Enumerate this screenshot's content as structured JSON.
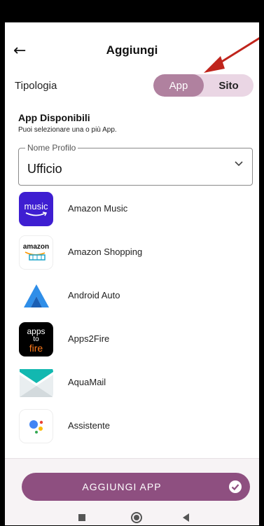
{
  "header": {
    "title": "Aggiungi",
    "back_icon": "arrow-left-icon"
  },
  "annotation": {
    "arrow_color": "#c0241c"
  },
  "tipologia": {
    "label": "Tipologia",
    "options": [
      "App",
      "Sito"
    ],
    "selected": "App"
  },
  "section": {
    "title": "App Disponibili",
    "subtitle": "Puoi selezionare una o più App."
  },
  "profile": {
    "label": "Nome Profilo",
    "value": "Ufficio"
  },
  "apps": [
    {
      "name": "Amazon Music",
      "icon_text": "music"
    },
    {
      "name": "Amazon Shopping",
      "icon_text": "amazon"
    },
    {
      "name": "Android Auto"
    },
    {
      "name": "Apps2Fire",
      "icon_lines": [
        "apps",
        "to",
        "fire"
      ]
    },
    {
      "name": "AquaMail"
    },
    {
      "name": "Assistente"
    }
  ],
  "action": {
    "label": "AGGIUNGI APP"
  },
  "colors": {
    "accent": "#8e4f80",
    "segment_selected": "#b0819f",
    "segment_bg": "#ead6e4"
  }
}
